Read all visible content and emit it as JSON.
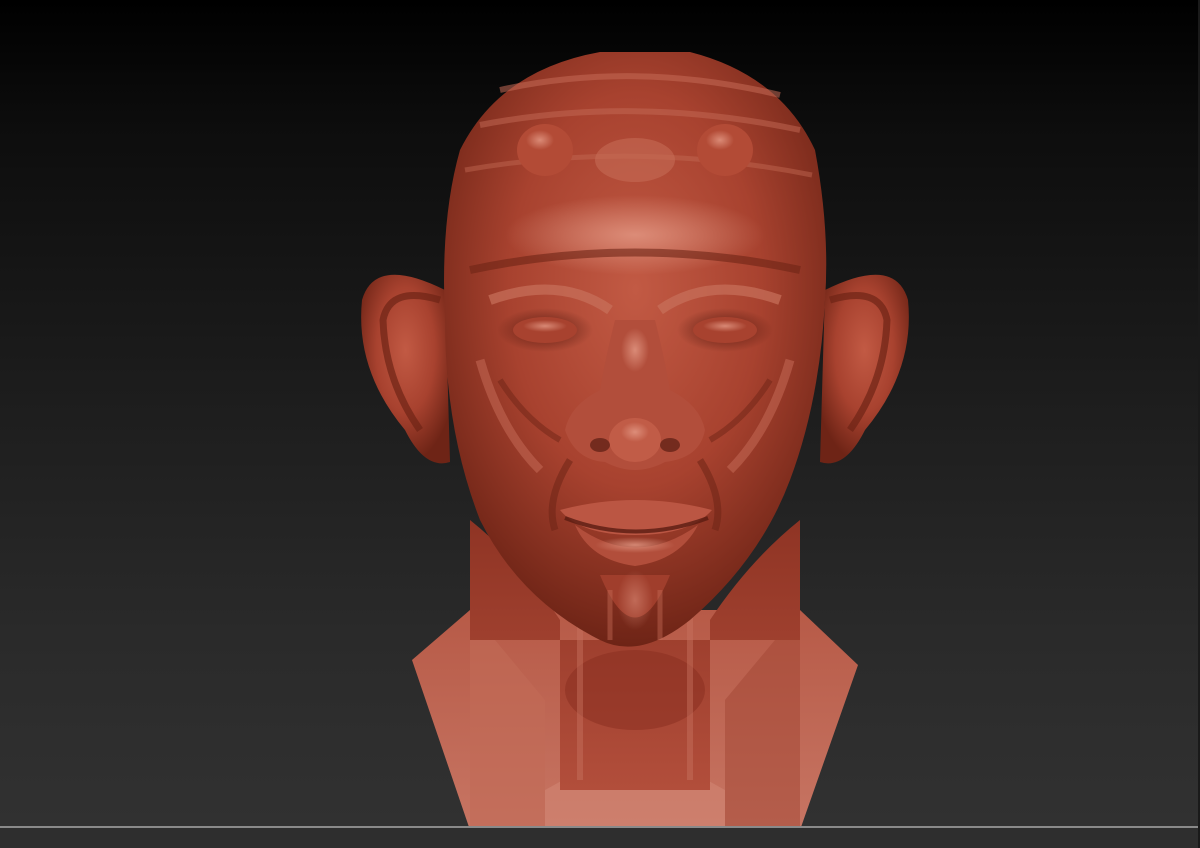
{
  "app": {
    "title": ""
  },
  "viewport": {
    "background_top": "#000000",
    "background_bottom": "#323232",
    "divider_color": "#8a8a8a"
  },
  "model": {
    "material_color": "#a8422f",
    "highlight_color": "#d8806a",
    "shadow_color": "#5a1c12"
  }
}
